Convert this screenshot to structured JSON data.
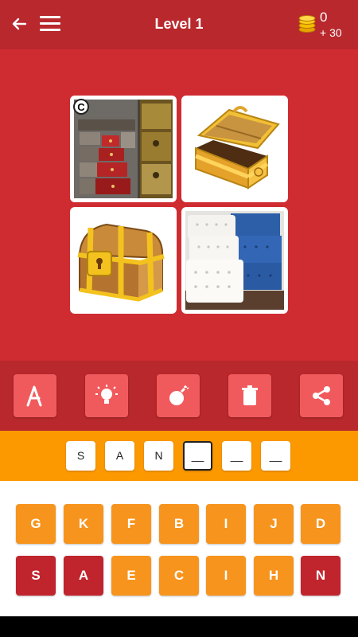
{
  "header": {
    "title": "Level 1",
    "coins": "0",
    "bonus": "+ 30"
  },
  "tiles": [
    {
      "name": "chests-stack-photo",
      "badge": "C"
    },
    {
      "name": "open-treasure-chest"
    },
    {
      "name": "closed-treasure-chest"
    },
    {
      "name": "white-blue-chests-photo"
    }
  ],
  "tools": [
    "reveal-letter",
    "hint-bulb",
    "bomb",
    "delete",
    "share"
  ],
  "answer": [
    "S",
    "A",
    "N",
    "__",
    "__",
    "__"
  ],
  "keyboard": {
    "row1": [
      "G",
      "K",
      "F",
      "B",
      "I",
      "J",
      "D"
    ],
    "row2": [
      "S",
      "A",
      "E",
      "C",
      "I",
      "H",
      "N"
    ]
  },
  "colors": {
    "primary": "#cf2c32",
    "dark": "#b8282d",
    "orange": "#fd9900",
    "key": "#f7941d",
    "used": "#c0242d",
    "tool": "#f15a5d"
  }
}
